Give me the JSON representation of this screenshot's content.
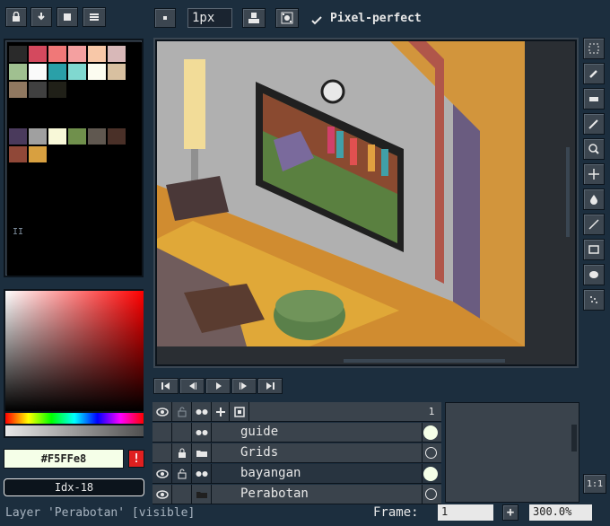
{
  "toolbar_top": {
    "icons": [
      "lock-icon",
      "download-icon",
      "stop-icon",
      "menu-icon"
    ],
    "brush_size": "1px",
    "pixel_perfect_label": "Pixel-perfect",
    "pixel_perfect_checked": true
  },
  "palette": {
    "rows": [
      [
        "#2a2a2a",
        "#d4495e",
        "#f07878",
        "#f4a0a0",
        "#f8c8a8",
        "#d8b8b8"
      ],
      [
        "#a0c090",
        "#fafafa",
        "#2aa0a8",
        "#80d8d0",
        "#fcfcf0",
        "#d8c0a0"
      ],
      [
        "#907860",
        "#404040",
        "#202018"
      ],
      [],
      [
        "#4a3a5c",
        "#a0a0a0",
        "#f8f8d8",
        "#70904c",
        "#605850",
        "#4a3028"
      ],
      [
        "#904838",
        "#d8a040"
      ]
    ],
    "page_label": "II"
  },
  "color_picker": {
    "hex": "#F5FFe8",
    "index": "Idx-18",
    "warning_icon": "warning-icon"
  },
  "timeline_controls": [
    "first-frame-icon",
    "prev-frame-icon",
    "play-icon",
    "next-frame-icon",
    "last-frame-icon"
  ],
  "layers": {
    "header_frame": "1",
    "rows": [
      {
        "name": "guide",
        "visible": false,
        "locked": false,
        "folder": false,
        "cel": "filled"
      },
      {
        "name": "Grids",
        "visible": false,
        "locked": true,
        "folder": true,
        "cel": "empty"
      },
      {
        "name": "bayangan",
        "visible": true,
        "locked": false,
        "folder": false,
        "cel": "filled",
        "selected": true
      },
      {
        "name": "Perabotan",
        "visible": true,
        "locked": false,
        "folder": true,
        "cel": "empty"
      }
    ]
  },
  "status": {
    "text": "Layer 'Perabotan' [visible]",
    "frame_label": "Frame:",
    "frame_value": "1",
    "add_label": "+",
    "zoom": "300.0%",
    "ratio_button": "1:1"
  },
  "colors": {
    "accent": "#f5ffe8",
    "background": "#1c2e3e",
    "warning": "#e02020"
  }
}
